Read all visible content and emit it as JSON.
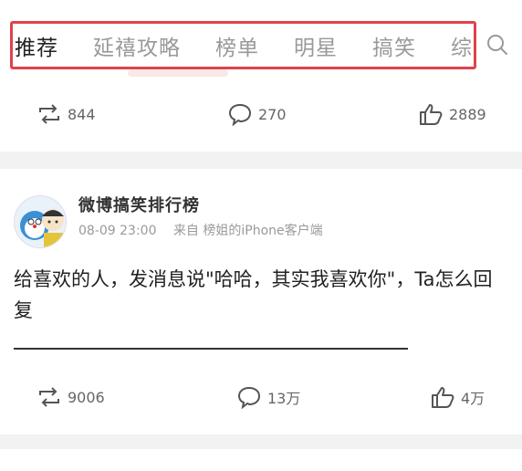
{
  "tabs": [
    "推荐",
    "延禧攻略",
    "榜单",
    "明星",
    "搞笑",
    "综"
  ],
  "post1": {
    "repost_count": "844",
    "comment_count": "270",
    "like_count": "2889"
  },
  "post2": {
    "author": "微博搞笑排行榜",
    "time": "08-09 23:00",
    "source": "来自 榜姐的iPhone客户端",
    "text": "给喜欢的人，发消息说\"哈哈，其实我喜欢你\"，Ta怎么回复",
    "repost_count": "9006",
    "comment_count": "13万",
    "like_count": "4万"
  },
  "icons": {
    "search": "search-icon",
    "repost": "repost-icon",
    "comment": "comment-icon",
    "like": "like-icon"
  },
  "colors": {
    "highlight_border": "#e0424b",
    "active_tab": "#222222",
    "inactive_tab": "#999999"
  }
}
